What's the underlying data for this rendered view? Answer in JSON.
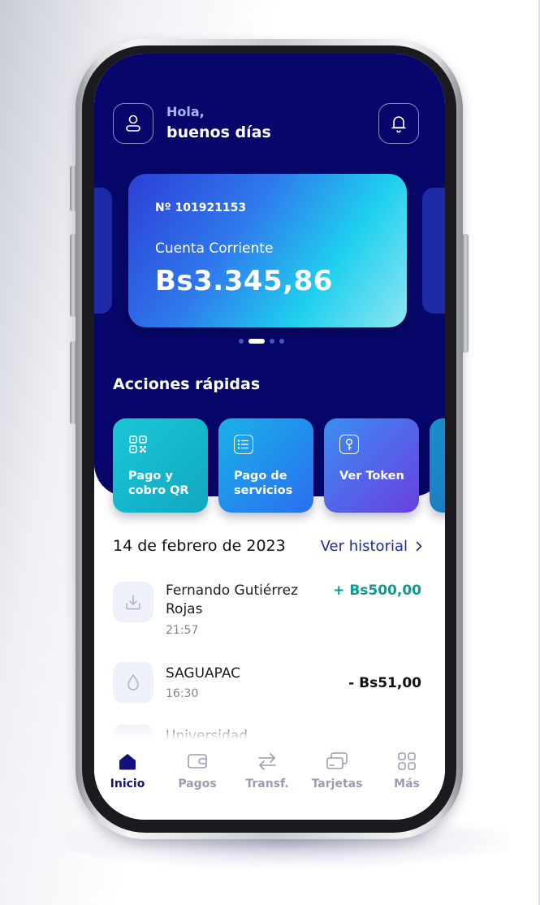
{
  "header": {
    "greeting_line1": "Hola,",
    "greeting_line2": "buenos días"
  },
  "account_card": {
    "number": "Nº 101921153",
    "type": "Cuenta Corriente",
    "balance": "Bs3.345,86",
    "carousel_active_index": 1,
    "carousel_count": 4
  },
  "quick_actions": {
    "title": "Acciones rápidas",
    "items": [
      {
        "label": "Pago y cobro QR",
        "icon": "qr-code-icon"
      },
      {
        "label": "Pago de servicios",
        "icon": "list-icon"
      },
      {
        "label": "Ver Token",
        "icon": "key-icon"
      }
    ]
  },
  "transactions": {
    "date": "14 de febrero de 2023",
    "history_link": "Ver historial",
    "items": [
      {
        "name": "Fernando Gutiérrez Rojas",
        "time": "21:57",
        "amount": "+ Bs500,00",
        "icon": "download-icon"
      },
      {
        "name": "SAGUAPAC",
        "time": "16:30",
        "amount": "- Bs51,00",
        "icon": "water-drop-icon"
      },
      {
        "name": "Universidad",
        "icon": "building-icon"
      }
    ]
  },
  "bottom_nav": {
    "items": [
      {
        "label": "Inicio",
        "icon": "home-icon",
        "active": true
      },
      {
        "label": "Pagos",
        "icon": "wallet-icon"
      },
      {
        "label": "Transf.",
        "icon": "transfer-icon"
      },
      {
        "label": "Tarjetas",
        "icon": "cards-icon"
      },
      {
        "label": "Más",
        "icon": "grid-icon"
      }
    ]
  },
  "colors": {
    "header_navy": "#07076b",
    "positive_amount": "#0e9a8d",
    "link_blue": "#1b2a9c",
    "nav_active": "#12127a"
  }
}
